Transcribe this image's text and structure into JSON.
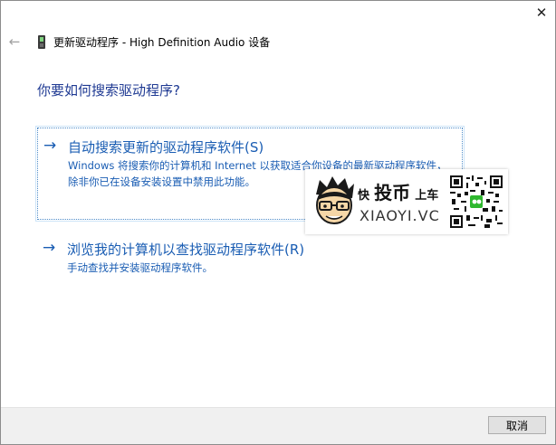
{
  "window": {
    "title": "更新驱动程序 - High Definition Audio 设备",
    "close_glyph": "✕",
    "back_glyph": "←",
    "icons": [
      "device-icon",
      "arrow-left-icon",
      "close-icon"
    ]
  },
  "main": {
    "question": "你要如何搜索驱动程序?",
    "options": [
      {
        "arrow": "→",
        "title": "自动搜索更新的驱动程序软件(S)",
        "description": "Windows 将搜索你的计算机和 Internet 以获取适合你设备的最新驱动程序软件，除非你已在设备安装设置中禁用此功能。"
      },
      {
        "arrow": "→",
        "title": "浏览我的计算机以查找驱动程序软件(R)",
        "description": "手动查找并安装驱动程序软件。"
      }
    ]
  },
  "watermark": {
    "brand_cn_1": "快",
    "brand_cn_2": "投币",
    "brand_cn_3": "上车",
    "brand_en": "XIAOYI.VC",
    "icons": [
      "cartoon-face-icon",
      "qr-code-icon"
    ]
  },
  "footer": {
    "cancel_label": "取消"
  },
  "colors": {
    "link": "#1a5db3",
    "heading": "#1f3a93",
    "footer_bg": "#f0f0f0"
  }
}
